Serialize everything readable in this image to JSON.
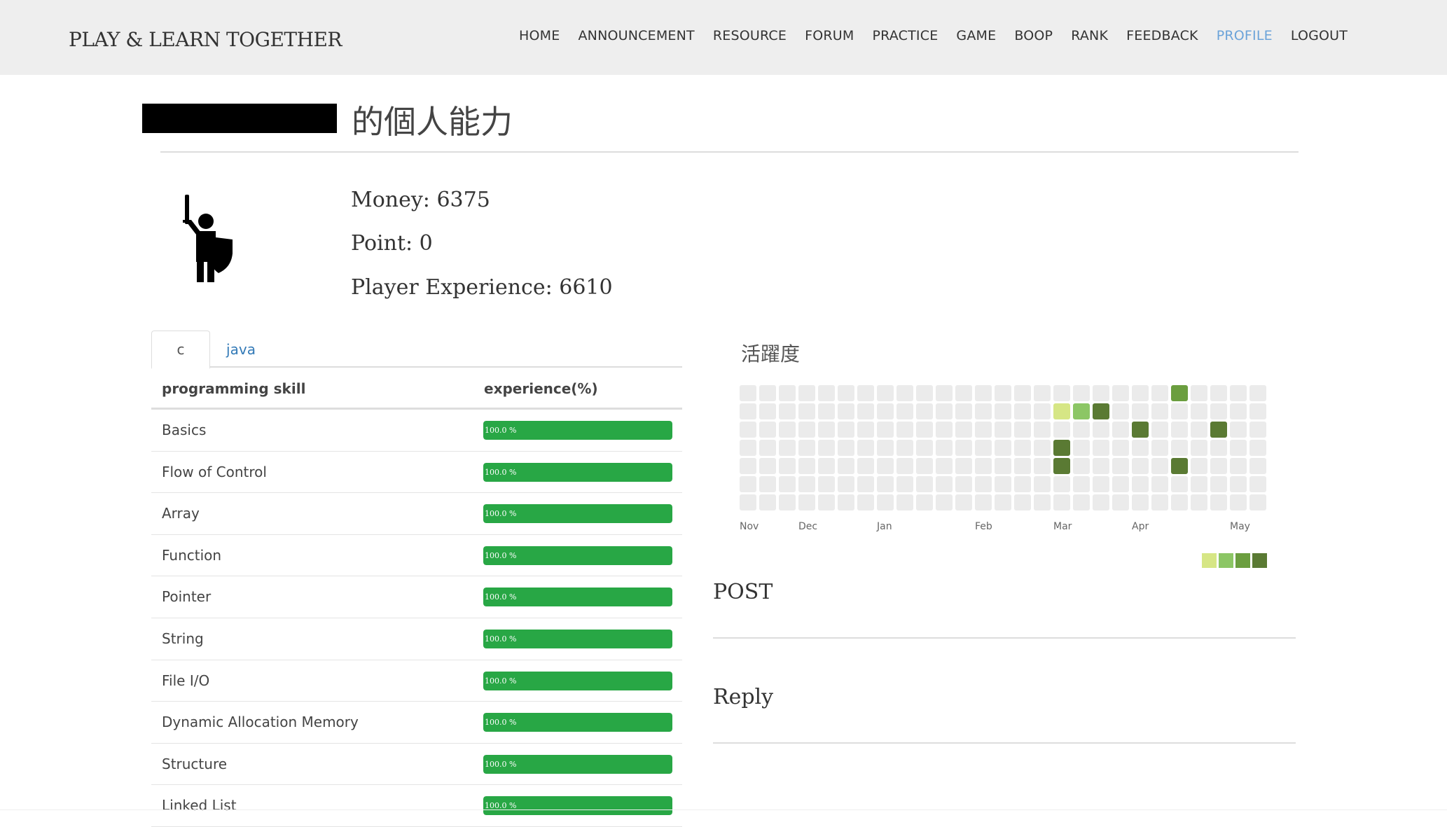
{
  "brand": "PLAY & LEARN TOGETHER",
  "nav": [
    {
      "label": "HOME",
      "active": false
    },
    {
      "label": "ANNOUNCEMENT",
      "active": false
    },
    {
      "label": "RESOURCE",
      "active": false
    },
    {
      "label": "FORUM",
      "active": false
    },
    {
      "label": "PRACTICE",
      "active": false
    },
    {
      "label": "GAME",
      "active": false
    },
    {
      "label": "BOOP",
      "active": false
    },
    {
      "label": "RANK",
      "active": false
    },
    {
      "label": "FEEDBACK",
      "active": false
    },
    {
      "label": "PROFILE",
      "active": true
    },
    {
      "label": "LOGOUT",
      "active": false
    }
  ],
  "page": {
    "title": "的個人能力"
  },
  "profile": {
    "avatar_icon": "knight-with-sword-and-shield-icon",
    "money": "Money: 6375",
    "point": "Point: 0",
    "experience": "Player Experience: 6610"
  },
  "tabs": [
    {
      "label": "c",
      "active": true
    },
    {
      "label": "java",
      "active": false
    }
  ],
  "skills": {
    "header_skill": "programming skill",
    "header_exp": "experience(%)",
    "rows": [
      {
        "name": "Basics",
        "percent": 100,
        "label": "100.0 %"
      },
      {
        "name": "Flow of Control",
        "percent": 100,
        "label": "100.0 %"
      },
      {
        "name": "Array",
        "percent": 100,
        "label": "100.0 %"
      },
      {
        "name": "Function",
        "percent": 100,
        "label": "100.0 %"
      },
      {
        "name": "Pointer",
        "percent": 100,
        "label": "100.0 %"
      },
      {
        "name": "String",
        "percent": 100,
        "label": "100.0 %"
      },
      {
        "name": "File I/O",
        "percent": 100,
        "label": "100.0 %"
      },
      {
        "name": "Dynamic Allocation Memory",
        "percent": 100,
        "label": "100.0 %"
      },
      {
        "name": "Structure",
        "percent": 100,
        "label": "100.0 %"
      },
      {
        "name": "Linked List",
        "percent": 100,
        "label": "100.0 %"
      }
    ]
  },
  "activity": {
    "title": "活躍度",
    "months": [
      "Nov",
      "Dec",
      "Jan",
      "Feb",
      "Mar",
      "Apr",
      "May"
    ],
    "month_week_index": [
      0,
      3,
      7,
      12,
      16,
      20,
      25
    ],
    "weeks": 27,
    "days": 7,
    "levels": [
      "#ebebeb",
      "#d6e685",
      "#8cc665",
      "#6b9e3f",
      "#5a7a33"
    ],
    "active_cells": [
      {
        "week": 16,
        "day": 1,
        "level": 1
      },
      {
        "week": 17,
        "day": 1,
        "level": 2
      },
      {
        "week": 18,
        "day": 1,
        "level": 4
      },
      {
        "week": 20,
        "day": 2,
        "level": 4
      },
      {
        "week": 22,
        "day": 0,
        "level": 3
      },
      {
        "week": 24,
        "day": 2,
        "level": 4
      },
      {
        "week": 16,
        "day": 3,
        "level": 4
      },
      {
        "week": 16,
        "day": 4,
        "level": 4
      },
      {
        "week": 22,
        "day": 4,
        "level": 4
      }
    ],
    "legend_levels": [
      1,
      2,
      3,
      4
    ]
  },
  "sections": {
    "post": "POST",
    "reply": "Reply"
  }
}
